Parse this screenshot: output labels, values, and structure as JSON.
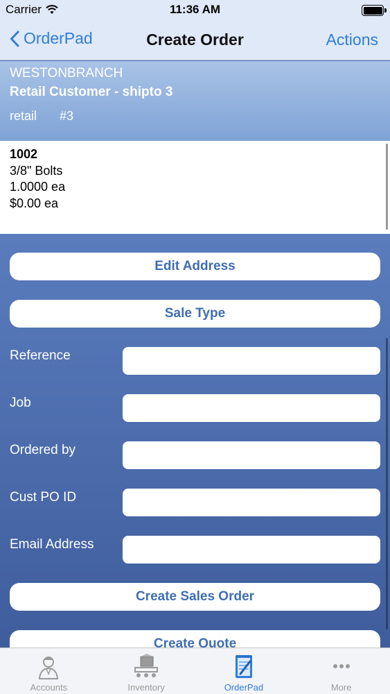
{
  "status": {
    "carrier": "Carrier",
    "time": "11:36 AM"
  },
  "nav": {
    "back_label": "OrderPad",
    "title": "Create Order",
    "actions_label": "Actions"
  },
  "account": {
    "branch": "WESTONBRANCH",
    "customer": "Retail Customer - shipto 3",
    "type": "retail",
    "number": "#3"
  },
  "item": {
    "code": "1002",
    "description": "3/8\" Bolts",
    "quantity": "1.0000 ea",
    "price": "$0.00 ea"
  },
  "form": {
    "edit_address_label": "Edit Address",
    "sale_type_label": "Sale Type",
    "fields": [
      {
        "label": "Reference",
        "value": ""
      },
      {
        "label": "Job",
        "value": ""
      },
      {
        "label": "Ordered by",
        "value": ""
      },
      {
        "label": "Cust PO ID",
        "value": ""
      },
      {
        "label": "Email Address",
        "value": ""
      }
    ],
    "create_sales_order_label": "Create Sales Order",
    "create_quote_label": "Create Quote"
  },
  "tabs": [
    {
      "label": "Accounts",
      "icon": "accounts-icon",
      "active": false
    },
    {
      "label": "Inventory",
      "icon": "inventory-icon",
      "active": false
    },
    {
      "label": "OrderPad",
      "icon": "orderpad-icon",
      "active": true
    },
    {
      "label": "More",
      "icon": "more-icon",
      "active": false
    }
  ],
  "colors": {
    "accent": "#2f7ed8",
    "header_bg": "#dfe9f7",
    "form_bg": "#4f6fae",
    "button_text": "#3f6db3"
  }
}
